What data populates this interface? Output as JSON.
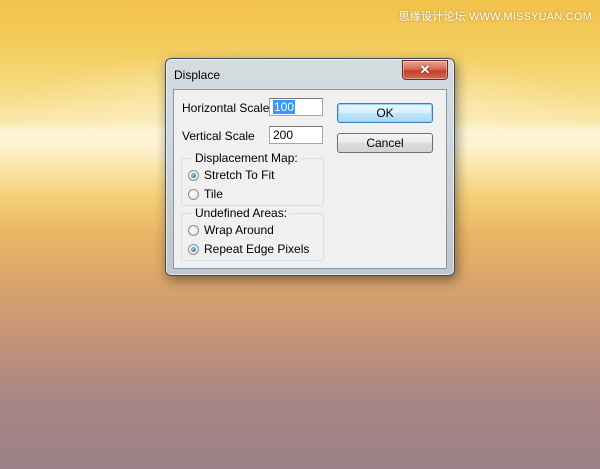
{
  "watermark": "思缘设计论坛 WWW.MISSYUAN.COM",
  "dialog": {
    "title": "Displace",
    "close_glyph": "✕",
    "horizontal_scale": {
      "label": "Horizontal Scale",
      "value": "100"
    },
    "vertical_scale": {
      "label": "Vertical Scale",
      "value": "200"
    },
    "ok_label": "OK",
    "cancel_label": "Cancel",
    "displacement_map": {
      "title": "Displacement Map:",
      "options": [
        {
          "label": "Stretch To Fit",
          "checked": true
        },
        {
          "label": "Tile",
          "checked": false
        }
      ]
    },
    "undefined_areas": {
      "title": "Undefined Areas:",
      "options": [
        {
          "label": "Wrap Around",
          "checked": false
        },
        {
          "label": "Repeat Edge Pixels",
          "checked": true
        }
      ]
    }
  }
}
